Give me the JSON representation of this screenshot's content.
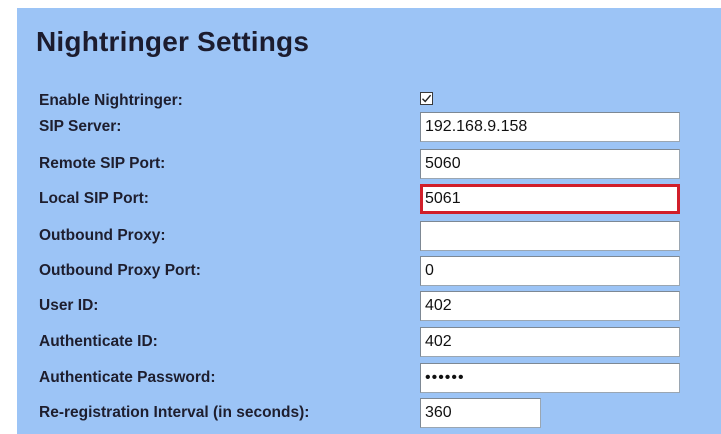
{
  "title": "Nightringer Settings",
  "fields": {
    "enable": {
      "label": "Enable Nightringer:",
      "checked": true
    },
    "sip_server": {
      "label": "SIP Server:",
      "value": "192.168.9.158"
    },
    "remote_sip_port": {
      "label": "Remote SIP Port:",
      "value": "5060"
    },
    "local_sip_port": {
      "label": "Local SIP Port:",
      "value": "5061"
    },
    "outbound_proxy": {
      "label": "Outbound Proxy:",
      "value": ""
    },
    "outbound_proxy_port": {
      "label": "Outbound Proxy Port:",
      "value": "0"
    },
    "user_id": {
      "label": "User ID:",
      "value": "402"
    },
    "authenticate_id": {
      "label": "Authenticate ID:",
      "value": "402"
    },
    "authenticate_password": {
      "label": "Authenticate Password:",
      "value": "••••••"
    },
    "reregistration_interval": {
      "label": "Re-registration Interval (in seconds):",
      "value": "360"
    }
  },
  "colors": {
    "panel": "#9cc4f6",
    "focus_border": "#d11f2a"
  }
}
